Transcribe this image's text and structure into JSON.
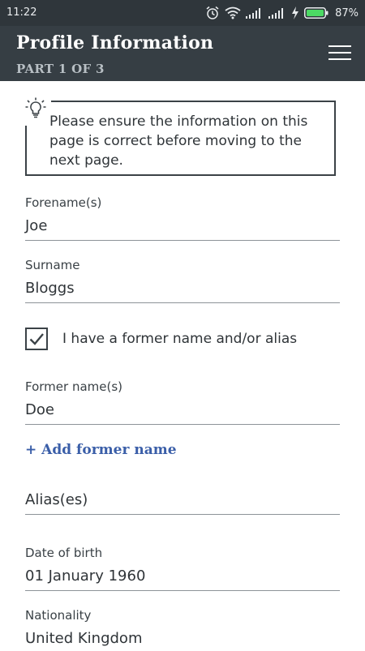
{
  "status_bar": {
    "time": "11:22",
    "battery_percent": "87%",
    "icons": [
      "alarm-icon",
      "wifi-icon",
      "signal-icon",
      "signal-icon",
      "charging-icon",
      "battery-icon"
    ]
  },
  "header": {
    "title": "Profile Information",
    "subtitle": "PART 1 OF 3",
    "menu_icon": "hamburger-menu-icon"
  },
  "notice": {
    "icon": "lightbulb-icon",
    "text": "Please ensure the information on this page is correct before moving to the next page."
  },
  "form": {
    "forename": {
      "label": "Forename(s)",
      "value": "Joe"
    },
    "surname": {
      "label": "Surname",
      "value": "Bloggs"
    },
    "former_name_checkbox": {
      "label": "I have a former name and/or alias",
      "checked": true
    },
    "former_names": {
      "label": "Former name(s)",
      "value": "Doe"
    },
    "add_former_name": "+ Add former name",
    "aliases": {
      "label": "Alias(es)",
      "value": ""
    },
    "date_of_birth": {
      "label": "Date of birth",
      "value": "01 January 1960"
    },
    "nationality": {
      "label": "Nationality",
      "value": "United Kingdom"
    }
  },
  "colors": {
    "status_bar": "#2f363b",
    "app_bar": "#363e44",
    "link": "#3a5ea8",
    "battery": "#4cd964"
  }
}
